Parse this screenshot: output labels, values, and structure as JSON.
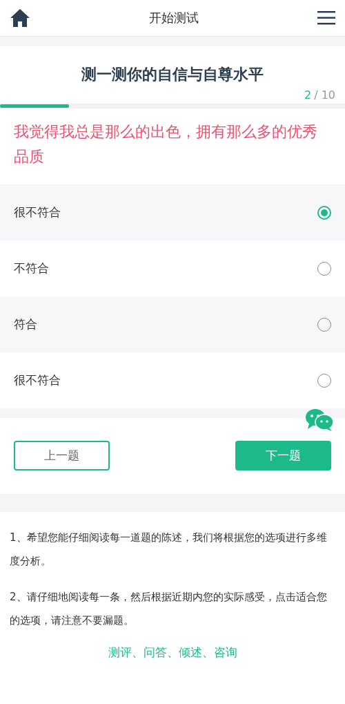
{
  "header": {
    "title": "开始测试"
  },
  "quiz": {
    "title": "测一测你的自信与自尊水平",
    "progress": {
      "current": "2",
      "total": "/ 10",
      "level": 0.2
    },
    "question": "我觉得我总是那么的出色，拥有那么多的优秀品质",
    "options": [
      {
        "label": "很不符合",
        "selected": true
      },
      {
        "label": "不符合",
        "selected": false
      },
      {
        "label": "符合",
        "selected": false
      },
      {
        "label": "很不符合",
        "selected": false
      }
    ]
  },
  "buttons": {
    "previous": "上一题",
    "next": "下一题"
  },
  "notes": [
    "1、希望您能仔细阅读每一道题的陈述，我们将根据您的选项进行多维度分析。",
    "2、请仔细地阅读每一条，然后根据近期内您的实际感受，点击适合您的选项，请注意不要漏题。"
  ],
  "footer": "测评、问答、倾述、咨询"
}
